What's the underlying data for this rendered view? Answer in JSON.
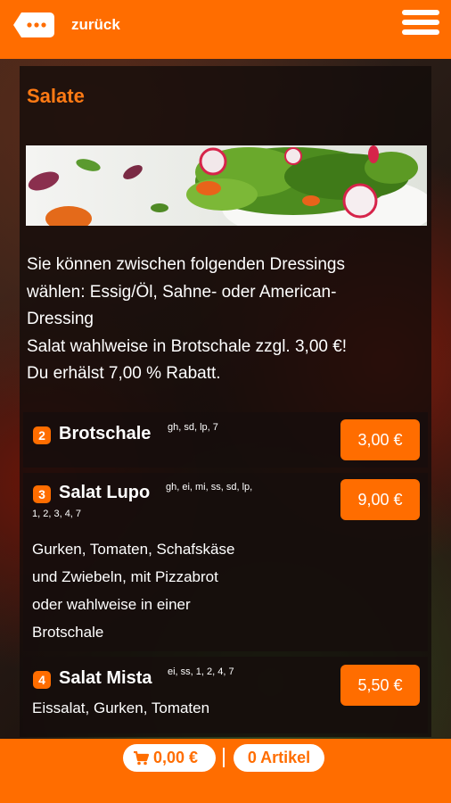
{
  "header": {
    "back_label": "zurück"
  },
  "category": {
    "title": "Salate",
    "intro_lines": [
      "Sie können zwischen folgenden Dressings",
      "wählen: Essig/Öl, Sahne- oder American-",
      "Dressing",
      "Salat wahlweise in Brotschale zzgl. 3,00 €!",
      "Du erhälst 7,00 % Rabatt."
    ]
  },
  "items": [
    {
      "number": "2",
      "name": "Brotschale",
      "allergens": "gh, sd, lp, 7",
      "price": "3,00 €"
    },
    {
      "number": "3",
      "name": "Salat Lupo",
      "allergens": "gh, ei, mi, ss, sd, lp,",
      "allergens_line2": "1, 2, 3, 4, 7",
      "price": "9,00 €",
      "description_lines": [
        "Gurken, Tomaten, Schafskäse",
        "und Zwiebeln, mit Pizzabrot",
        "oder wahlweise in einer",
        "Brotschale"
      ]
    },
    {
      "number": "4",
      "name": "Salat Mista",
      "allergens": "ei, ss, 1, 2, 4, 7",
      "price": "5,50 €",
      "description": "Eissalat, Gurken, Tomaten"
    }
  ],
  "cart": {
    "total": "0,00 €",
    "count_label": "0 Artikel"
  },
  "colors": {
    "accent": "#ff6d00",
    "title": "#ff7a14"
  }
}
